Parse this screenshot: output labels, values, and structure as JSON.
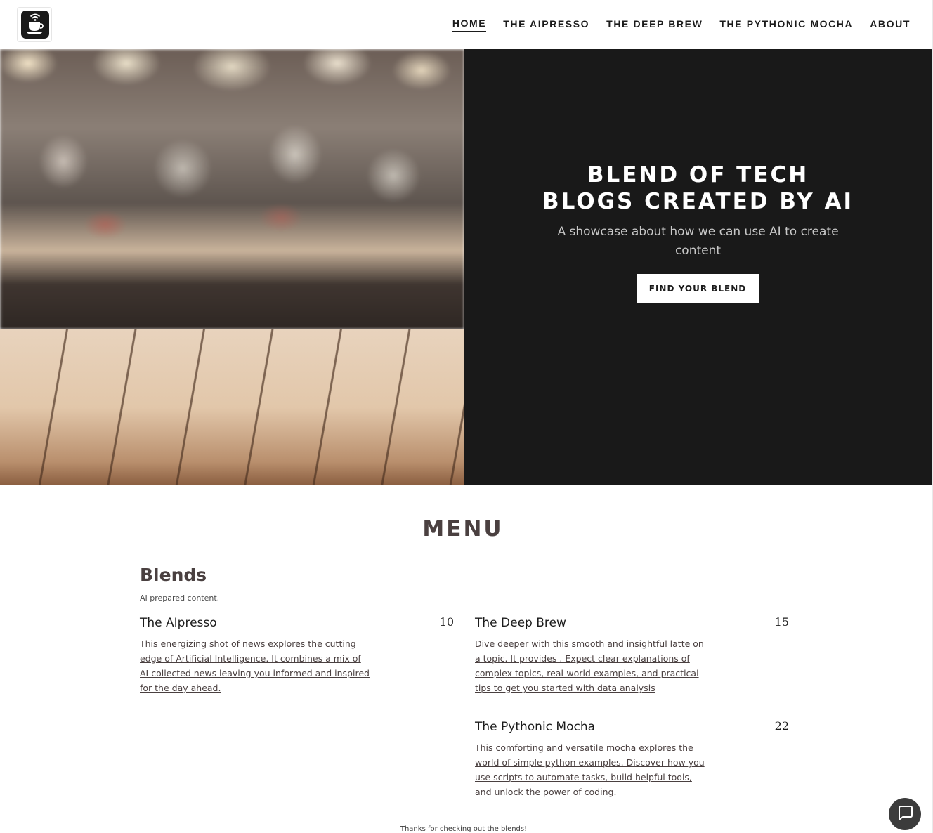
{
  "header": {
    "logo_icon": "coffee-cup-wifi-icon",
    "nav": [
      {
        "label": "HOME",
        "active": true
      },
      {
        "label": "THE AIPRESSO"
      },
      {
        "label": "THE DEEP BREW"
      },
      {
        "label": "THE PYTHONIC MOCHA"
      },
      {
        "label": "ABOUT"
      }
    ]
  },
  "hero": {
    "image_alt": "blurred coffee shop counter with wooden table",
    "title_line1": "BLEND OF TECH",
    "title_line2": "BLOGS CREATED BY AI",
    "subtitle": "A showcase about how we can use AI to create content",
    "button_label": "FIND YOUR BLEND",
    "dark_bg": "#191919"
  },
  "menu": {
    "title": "MENU",
    "category_title": "Blends",
    "category_subtitle": "AI prepared content.",
    "items": [
      {
        "name": "The AIpresso",
        "price": "10",
        "description": "This energizing shot of news explores the cutting edge of Artificial Intelligence. It combines a mix of AI collected news leaving you informed and inspired for the day ahead."
      },
      {
        "name": "The Deep Brew",
        "price": "15",
        "description": "Dive deeper with this smooth and insightful latte on a topic. It provides . Expect clear explanations of complex topics, real-world examples, and practical tips to get you started with data analysis"
      },
      {
        "name": "The Pythonic Mocha",
        "price": "22",
        "description": "This comforting and versatile mocha explores the world of simple python examples. Discover how you use scripts to automate tasks, build helpful tools, and unlock the power of coding."
      }
    ]
  },
  "footer": {
    "note": "Thanks for checking out the blends!"
  },
  "chat": {
    "icon": "chat-bubble-icon"
  }
}
